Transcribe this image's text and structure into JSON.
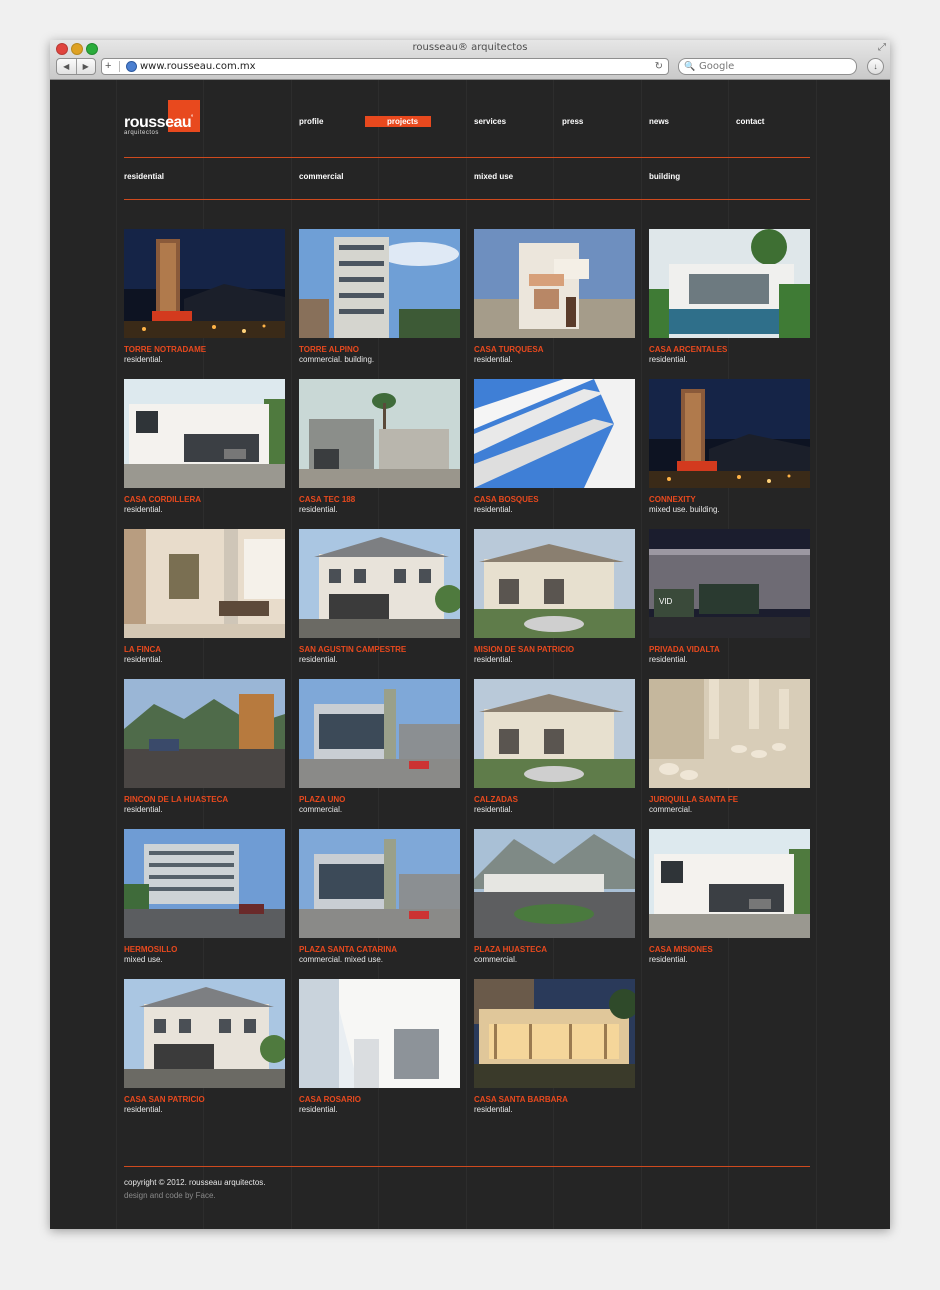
{
  "browser": {
    "window_title": "rousseau® arquitectos",
    "url": "www.rousseau.com.mx",
    "search_placeholder": "Google"
  },
  "logo": {
    "name": "rousseau",
    "mark": "˚",
    "subtitle": "arquitectos"
  },
  "nav": [
    "profile",
    "projects",
    "services",
    "press",
    "news",
    "contact"
  ],
  "nav_active": "projects",
  "categories": [
    "residential",
    "commercial",
    "mixed use",
    "building"
  ],
  "colors": {
    "accent": "#e8491e",
    "background": "#252525",
    "text": "#ffffff"
  },
  "projects": [
    {
      "title": "TORRE NOTRADAME",
      "type": "residential.",
      "scene": "night-tower"
    },
    {
      "title": "TORRE ALPINO",
      "type": "commercial. building.",
      "scene": "day-tower"
    },
    {
      "title": "CASA TURQUESA",
      "type": "residential.",
      "scene": "dusk-house"
    },
    {
      "title": "CASA ARCENTALES",
      "type": "residential.",
      "scene": "pool-house"
    },
    {
      "title": "CASA CORDILLERA",
      "type": "residential.",
      "scene": "white-house"
    },
    {
      "title": "CASA TEC 188",
      "type": "residential.",
      "scene": "grey-house"
    },
    {
      "title": "CASA BOSQUES",
      "type": "residential.",
      "scene": "blue-abstract"
    },
    {
      "title": "CONNEXITY",
      "type": "mixed use. building.",
      "scene": "night-tower"
    },
    {
      "title": "LA FINCA",
      "type": "residential.",
      "scene": "interior"
    },
    {
      "title": "SAN AGUSTIN CAMPESTRE",
      "type": "residential.",
      "scene": "mansion"
    },
    {
      "title": "MISION DE SAN PATRICIO",
      "type": "residential.",
      "scene": "villa"
    },
    {
      "title": "PRIVADA VIDALTA",
      "type": "residential.",
      "scene": "night-wall"
    },
    {
      "title": "RINCON DE LA HUASTECA",
      "type": "residential.",
      "scene": "mountain-road"
    },
    {
      "title": "PLAZA UNO",
      "type": "commercial.",
      "scene": "plaza"
    },
    {
      "title": "CALZADAS",
      "type": "residential.",
      "scene": "villa"
    },
    {
      "title": "JURIQUILLA SANTA FE",
      "type": "commercial.",
      "scene": "model"
    },
    {
      "title": "HERMOSILLO",
      "type": "mixed use.",
      "scene": "hotel"
    },
    {
      "title": "PLAZA SANTA CATARINA",
      "type": "commercial. mixed use.",
      "scene": "plaza"
    },
    {
      "title": "PLAZA HUASTECA",
      "type": "commercial.",
      "scene": "mountain-plaza"
    },
    {
      "title": "CASA MISIONES",
      "type": "residential.",
      "scene": "white-house"
    },
    {
      "title": "CASA SAN PATRICIO",
      "type": "residential.",
      "scene": "mansion"
    },
    {
      "title": "CASA ROSARIO",
      "type": "residential.",
      "scene": "white-facade"
    },
    {
      "title": "CASA SANTA BARBARA",
      "type": "residential.",
      "scene": "dusk-villa"
    }
  ],
  "footer": {
    "copyright": "copyright © 2012. rousseau arquitectos.",
    "credit": "design and code by Face."
  }
}
